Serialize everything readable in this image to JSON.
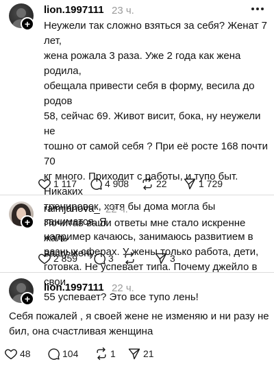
{
  "posts": [
    {
      "username": "lion.1997111",
      "time": "23 ч.",
      "avatar": "avatar-icon",
      "text": "Неужели так сложно взяться за себя? Женат 7 лет,\nжена рожала 3 раза. Уже 2 года как жена родила,\nобещала привести себя в форму, весила до родов\n58, сейчас 69. Живот висит, бока, ну неужели не\nтошно от самой себя ? При её росте 168 почти 70\nкг много. Приходит с работы, и тупо быт. Никаких\nтренировок, хотя бы дома могла бы заниматся. Я\nнапример качаюсь, занимаюсь развитием в\nразных сферах. У жены только работа, дети,\nготовка. Не успевает типа. Почему джейло в свои\n55 успевает? Это все тупо лень!",
      "likes": "1 117",
      "replies": "4 908",
      "reposts": "22",
      "shares": "1 729"
    },
    {
      "username": "raimjanova_",
      "time": "22 ч.",
      "avatar": "avatar-photo",
      "text": "Почитав ваши ответы мне стало искренне жаль\nвашу жену.",
      "likes": "2 859",
      "replies": "3",
      "reposts": "",
      "shares": "3"
    },
    {
      "username": "lion.1997111",
      "time": "22 ч.",
      "avatar": "avatar-icon",
      "text": "Себя пожалей , я своей жене не изменяю и ни разу не\nбил, она счастливая женщина",
      "likes": "48",
      "replies": "104",
      "reposts": "1",
      "shares": "21"
    }
  ],
  "colors": {
    "text": "#111111",
    "muted": "#9a9a9a",
    "divider": "#dcdcdc"
  }
}
